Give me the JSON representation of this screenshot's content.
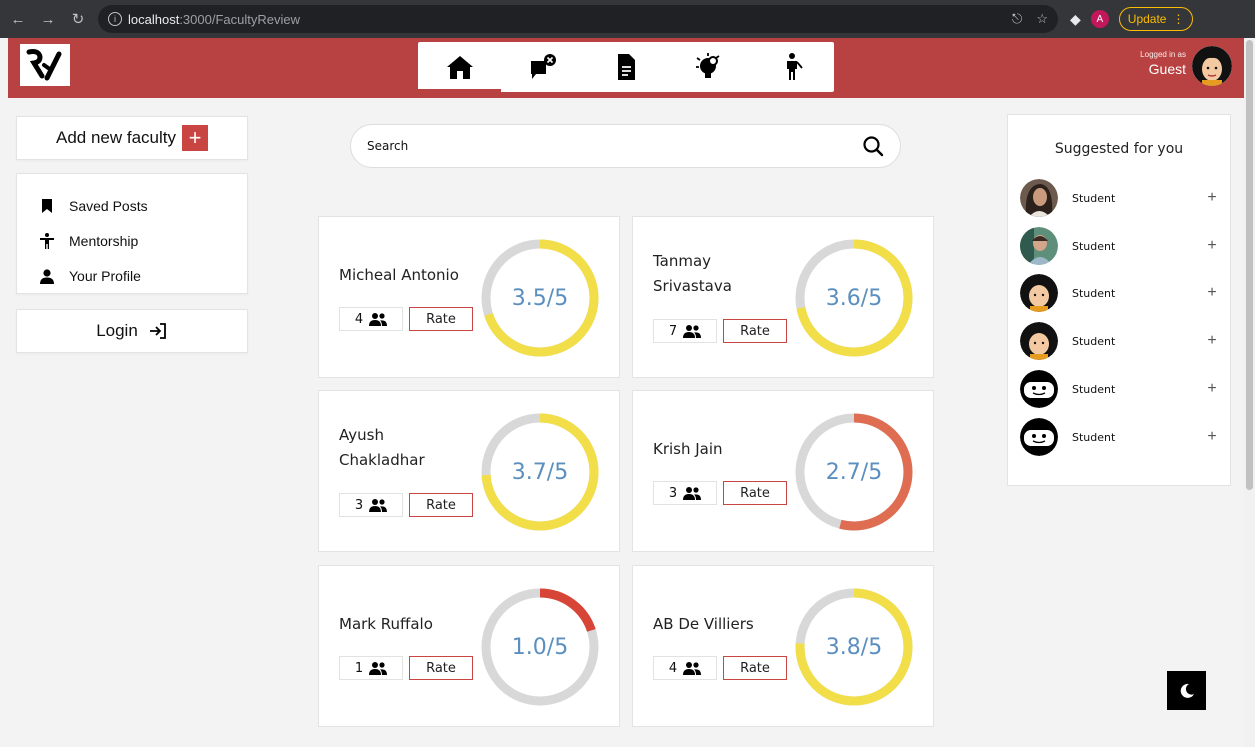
{
  "browser": {
    "url_host": "localhost",
    "url_path": ":3000/FacultyReview",
    "profile_initial": "A",
    "update_label": "Update"
  },
  "header": {
    "logged_in_label": "Logged in as",
    "user": "Guest",
    "accent_color": "#b84241",
    "nav": [
      "home-icon",
      "feedback-icon",
      "document-icon",
      "idea-icon",
      "mentor-icon"
    ]
  },
  "sidebar": {
    "add_label": "Add new faculty",
    "items": [
      {
        "label": "Saved Posts",
        "icon": "bookmark-icon"
      },
      {
        "label": "Mentorship",
        "icon": "person-icon"
      },
      {
        "label": "Your Profile",
        "icon": "profile-icon"
      }
    ],
    "login_label": "Login"
  },
  "search": {
    "placeholder": "Search"
  },
  "faculty": [
    {
      "name": "Micheal Antonio",
      "count": "4",
      "rate_label": "Rate",
      "score": 3.5,
      "score_text": "3.5/5"
    },
    {
      "name": "Tanmay Srivastava",
      "count": "7",
      "rate_label": "Rate",
      "score": 3.6,
      "score_text": "3.6/5"
    },
    {
      "name": "Ayush Chakladhar",
      "count": "3",
      "rate_label": "Rate",
      "score": 3.7,
      "score_text": "3.7/5"
    },
    {
      "name": "Krish Jain",
      "count": "3",
      "rate_label": "Rate",
      "score": 2.7,
      "score_text": "2.7/5"
    },
    {
      "name": "Mark Ruffalo",
      "count": "1",
      "rate_label": "Rate",
      "score": 1.0,
      "score_text": "1.0/5"
    },
    {
      "name": "AB De Villiers",
      "count": "4",
      "rate_label": "Rate",
      "score": 3.8,
      "score_text": "3.8/5"
    }
  ],
  "score_colors": {
    "high": "#f2de48",
    "mid": "#de6d52",
    "low": "#d64535",
    "track": "#d8d8d8",
    "label": "#5b8fbf"
  },
  "suggested": {
    "title": "Suggested for you",
    "items": [
      {
        "name": "Student",
        "avatar": "photo"
      },
      {
        "name": "Student",
        "avatar": "photo2"
      },
      {
        "name": "Student",
        "avatar": "cartoon"
      },
      {
        "name": "Student",
        "avatar": "cartoon"
      },
      {
        "name": "Student",
        "avatar": "mask"
      },
      {
        "name": "Student",
        "avatar": "mask"
      }
    ]
  }
}
